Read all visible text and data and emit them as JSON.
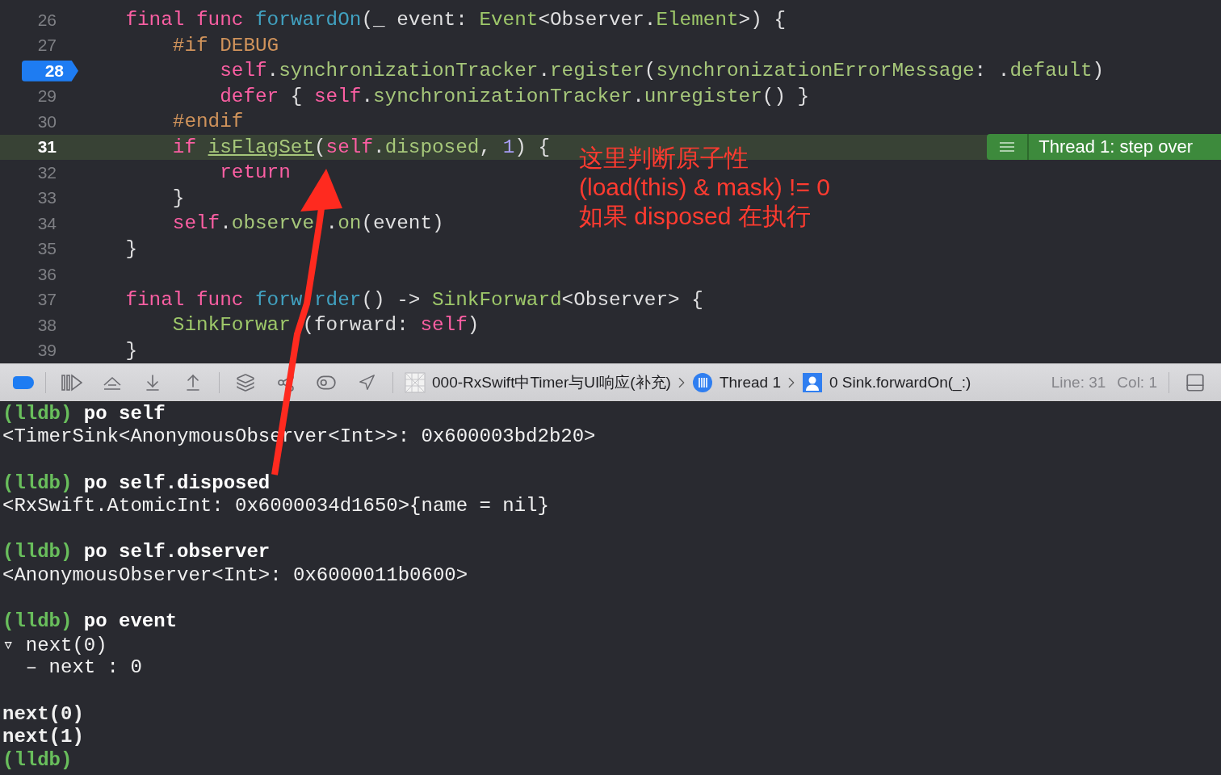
{
  "editor": {
    "lines": [
      {
        "number": "26",
        "breakpoint": false,
        "current": false,
        "tokens": [
          {
            "kind": "keyword",
            "text": "    final func "
          },
          {
            "kind": "function",
            "text": "forwardOn"
          },
          {
            "kind": "plain",
            "text": "(_ event: "
          },
          {
            "kind": "type",
            "text": "Event"
          },
          {
            "kind": "plain",
            "text": "<Observer."
          },
          {
            "kind": "type",
            "text": "Element"
          },
          {
            "kind": "plain",
            "text": ">) {"
          }
        ]
      },
      {
        "number": "27",
        "breakpoint": false,
        "current": false,
        "tokens": [
          {
            "kind": "macro",
            "text": "        #if DEBUG"
          }
        ]
      },
      {
        "number": "28",
        "breakpoint": true,
        "current": false,
        "tokens": [
          {
            "kind": "keyword",
            "text": "            self"
          },
          {
            "kind": "plain",
            "text": "."
          },
          {
            "kind": "member",
            "text": "synchronizationTracker"
          },
          {
            "kind": "plain",
            "text": "."
          },
          {
            "kind": "member",
            "text": "register"
          },
          {
            "kind": "plain",
            "text": "("
          },
          {
            "kind": "member",
            "text": "synchronizationErrorMessage"
          },
          {
            "kind": "plain",
            "text": ": ."
          },
          {
            "kind": "member",
            "text": "default"
          },
          {
            "kind": "plain",
            "text": ")"
          }
        ]
      },
      {
        "number": "29",
        "breakpoint": false,
        "current": false,
        "tokens": [
          {
            "kind": "keyword",
            "text": "            defer"
          },
          {
            "kind": "plain",
            "text": " { "
          },
          {
            "kind": "keyword",
            "text": "self"
          },
          {
            "kind": "plain",
            "text": "."
          },
          {
            "kind": "member",
            "text": "synchronizationTracker"
          },
          {
            "kind": "plain",
            "text": "."
          },
          {
            "kind": "member",
            "text": "unregister"
          },
          {
            "kind": "plain",
            "text": "() }"
          }
        ]
      },
      {
        "number": "30",
        "breakpoint": false,
        "current": false,
        "tokens": [
          {
            "kind": "macro",
            "text": "        #endif"
          }
        ]
      },
      {
        "number": "31",
        "breakpoint": false,
        "current": true,
        "tokens": [
          {
            "kind": "keyword",
            "text": "        if "
          },
          {
            "kind": "link",
            "text": "isFlagSet"
          },
          {
            "kind": "plain",
            "text": "("
          },
          {
            "kind": "keyword",
            "text": "self"
          },
          {
            "kind": "plain",
            "text": "."
          },
          {
            "kind": "member",
            "text": "disposed"
          },
          {
            "kind": "plain",
            "text": ", "
          },
          {
            "kind": "number",
            "text": "1"
          },
          {
            "kind": "plain",
            "text": ") {"
          }
        ]
      },
      {
        "number": "32",
        "breakpoint": false,
        "current": false,
        "tokens": [
          {
            "kind": "keyword",
            "text": "            return"
          }
        ]
      },
      {
        "number": "33",
        "breakpoint": false,
        "current": false,
        "tokens": [
          {
            "kind": "plain",
            "text": "        }"
          }
        ]
      },
      {
        "number": "34",
        "breakpoint": false,
        "current": false,
        "tokens": [
          {
            "kind": "keyword",
            "text": "        self"
          },
          {
            "kind": "plain",
            "text": "."
          },
          {
            "kind": "member",
            "text": "observe"
          },
          {
            "kind": "gap"
          },
          {
            "kind": "plain",
            "text": "."
          },
          {
            "kind": "member",
            "text": "on"
          },
          {
            "kind": "plain",
            "text": "(event)"
          }
        ]
      },
      {
        "number": "35",
        "breakpoint": false,
        "current": false,
        "tokens": [
          {
            "kind": "plain",
            "text": "    }"
          }
        ]
      },
      {
        "number": "36",
        "breakpoint": false,
        "current": false
      },
      {
        "number": "37",
        "breakpoint": false,
        "current": false,
        "tokens": [
          {
            "kind": "keyword",
            "text": "    final func "
          },
          {
            "kind": "function",
            "text": "forw"
          },
          {
            "kind": "gap"
          },
          {
            "kind": "function",
            "text": "rder"
          },
          {
            "kind": "plain",
            "text": "() -> "
          },
          {
            "kind": "type",
            "text": "SinkForward"
          },
          {
            "kind": "plain",
            "text": "<Observer> {"
          }
        ]
      },
      {
        "number": "38",
        "breakpoint": false,
        "current": false,
        "tokens": [
          {
            "kind": "type",
            "text": "        SinkForwar"
          },
          {
            "kind": "gap"
          },
          {
            "kind": "plain",
            "text": "(forward: "
          },
          {
            "kind": "keyword",
            "text": "self"
          },
          {
            "kind": "plain",
            "text": ")"
          }
        ]
      },
      {
        "number": "39",
        "breakpoint": false,
        "current": false,
        "tokens": [
          {
            "kind": "plain",
            "text": "    }"
          }
        ]
      }
    ],
    "thread_badge": {
      "label": "Thread 1: step over"
    }
  },
  "annotation": {
    "lines": [
      "这里判断原子性",
      "(load(this) & mask) != 0",
      "如果 disposed 在执行"
    ]
  },
  "debug_bar": {
    "breakpoints_active": true,
    "breadcrumbs": [
      {
        "kind": "file",
        "label": "000-RxSwift中Timer与UI响应(补充)"
      },
      {
        "kind": "thread",
        "label": "Thread 1"
      },
      {
        "kind": "frame",
        "label": "0 Sink.forwardOn(_:)"
      }
    ],
    "line": "Line: 31",
    "col": "Col: 1"
  },
  "console": {
    "lines": [
      {
        "kind": "command",
        "prompt": "(lldb)",
        "text": "po self"
      },
      {
        "kind": "output",
        "text": "<TimerSink<AnonymousObserver<Int>>: 0x600003bd2b20>"
      },
      {
        "kind": "blank"
      },
      {
        "kind": "command",
        "prompt": "(lldb)",
        "text": "po self.disposed"
      },
      {
        "kind": "output",
        "text": "<RxSwift.AtomicInt: 0x6000034d1650>{name = nil}"
      },
      {
        "kind": "blank"
      },
      {
        "kind": "command",
        "prompt": "(lldb)",
        "text": "po self.observer"
      },
      {
        "kind": "output",
        "text": "<AnonymousObserver<Int>: 0x6000011b0600>"
      },
      {
        "kind": "blank"
      },
      {
        "kind": "command",
        "prompt": "(lldb)",
        "text": "po event"
      },
      {
        "kind": "output",
        "text": "▿ next(0)"
      },
      {
        "kind": "output",
        "text": "  – next : 0"
      },
      {
        "kind": "blank"
      },
      {
        "kind": "stdout",
        "text": "next(0)"
      },
      {
        "kind": "stdout",
        "text": "next(1)"
      },
      {
        "kind": "command",
        "prompt": "(lldb)"
      }
    ]
  }
}
